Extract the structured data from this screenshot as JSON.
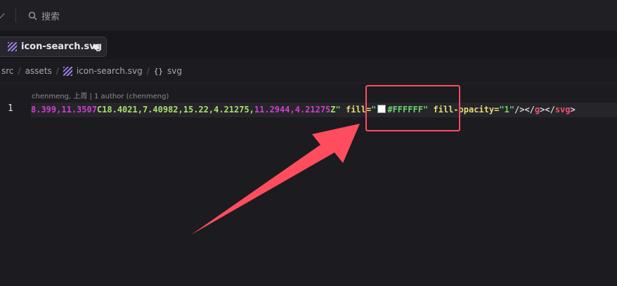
{
  "titlebar": {
    "search_label": "搜索"
  },
  "tab": {
    "filename": "icon-search.svg",
    "file_icon": "svg-file-icon",
    "unsaved": true
  },
  "breadcrumb": {
    "items": [
      "src",
      "assets",
      "icon-search.svg",
      "svg"
    ],
    "separator": "/",
    "symbol_icon": "{}"
  },
  "editor": {
    "blame": "chenmeng, 上周 | 1 author (chenmeng)",
    "line_number": "1",
    "code": {
      "t1": "8.399,11.3507",
      "t2": "C",
      "t3": "18.4021,7.40982,15.22,4.21275,",
      "t4": "11.2944,4.21275",
      "t5": "Z",
      "t6": "\"",
      "t7": "fill=",
      "t8": "\"",
      "t9": "#FFFFFF",
      "t10": "\"",
      "t11": "fill-opacity=",
      "t12": "\"1\"",
      "t13": "/></",
      "t14": "g",
      "t15": "></",
      "t16": "svg",
      "t17": ">"
    },
    "swatch_color": "#FFFFFF"
  },
  "annotation": {
    "highlight_color": "#ff4d5e"
  }
}
